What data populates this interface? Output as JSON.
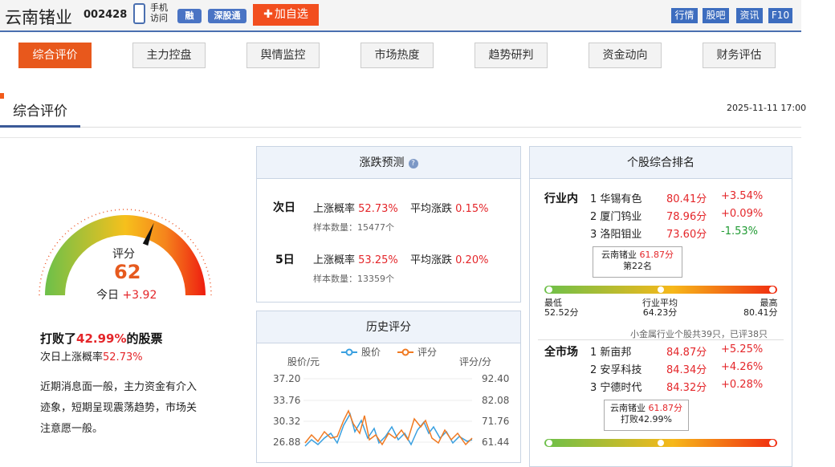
{
  "header": {
    "stock_name": "云南锗业",
    "stock_code": "002428",
    "phone_label_1": "手机",
    "phone_label_2": "访问",
    "badge_margin": "融",
    "badge_sz_connect": "深股通",
    "add_watchlist": "加自选",
    "links": [
      "行情",
      "股吧",
      "资讯",
      "F10"
    ]
  },
  "tabs": [
    "综合评价",
    "主力控盘",
    "舆情监控",
    "市场热度",
    "趋势研判",
    "资金动向",
    "财务评估"
  ],
  "section": {
    "title": "综合评价",
    "date": "2025-11-11 17:00"
  },
  "gauge": {
    "label": "评分",
    "score": "62",
    "score_fraction": 0.62,
    "today_label": "今日",
    "today_change": "+3.92"
  },
  "beat": {
    "prefix": "打败了",
    "percent": "42.99%",
    "suffix": "的股票",
    "next_label": "次日上涨概率",
    "next_value": "52.73%"
  },
  "description": "近期消息面一般，主力资金有介入迹象，短期呈现震荡趋势，市场关注意愿一般。",
  "prediction": {
    "title": "涨跌预测",
    "rows": [
      {
        "day": "次日",
        "rise_label": "上涨概率",
        "rise_value": "52.73%",
        "avg_label": "平均涨跌",
        "avg_value": "0.15%",
        "sample": "样本数量：15477个"
      },
      {
        "day": "5日",
        "rise_label": "上涨概率",
        "rise_value": "53.25%",
        "avg_label": "平均涨跌",
        "avg_value": "0.20%",
        "sample": "样本数量：13359个"
      }
    ]
  },
  "history": {
    "title": "历史评分",
    "left_axis_label": "股价/元",
    "right_axis_label": "评分/分",
    "legend_price": "股价",
    "legend_score": "评分",
    "left_ticks": [
      "37.20",
      "33.76",
      "30.32",
      "26.88"
    ],
    "right_ticks": [
      "92.40",
      "82.08",
      "71.76",
      "61.44"
    ]
  },
  "ranking": {
    "title": "个股综合排名",
    "industry": {
      "label": "行业内",
      "rows": [
        {
          "rank": "1",
          "name": "华锡有色",
          "score": "80.41分",
          "change": "+3.54%"
        },
        {
          "rank": "2",
          "name": "厦门钨业",
          "score": "78.96分",
          "change": "+0.09%"
        },
        {
          "rank": "3",
          "name": "洛阳钼业",
          "score": "73.60分",
          "change": "-1.53%"
        }
      ],
      "callout_name": "云南锗业",
      "callout_score": "61.87分",
      "callout_sub": "第22名",
      "marker_fraction": 0.52,
      "low_label": "最低",
      "low_value": "52.52分",
      "avg_label": "行业平均",
      "avg_value": "64.23分",
      "high_label": "最高",
      "high_value": "80.41分",
      "footnote": "小金属行业个股共39只，已评38只"
    },
    "market": {
      "label": "全市场",
      "rows": [
        {
          "rank": "1",
          "name": "新亩邦",
          "score": "84.87分",
          "change": "+5.25%"
        },
        {
          "rank": "2",
          "name": "安孚科技",
          "score": "84.34分",
          "change": "+4.26%"
        },
        {
          "rank": "3",
          "name": "宁德时代",
          "score": "84.32分",
          "change": "+0.28%"
        }
      ],
      "callout_name": "云南锗业",
      "callout_score": "61.87分",
      "callout_sub": "打败42.99%"
    }
  },
  "colors": {
    "accent": "#e8581c",
    "rise": "#e4262a",
    "fall": "#1f9a32",
    "brand_blue": "#3d6dbf",
    "price_line": "#3aa0e0",
    "score_line": "#f07a22"
  }
}
